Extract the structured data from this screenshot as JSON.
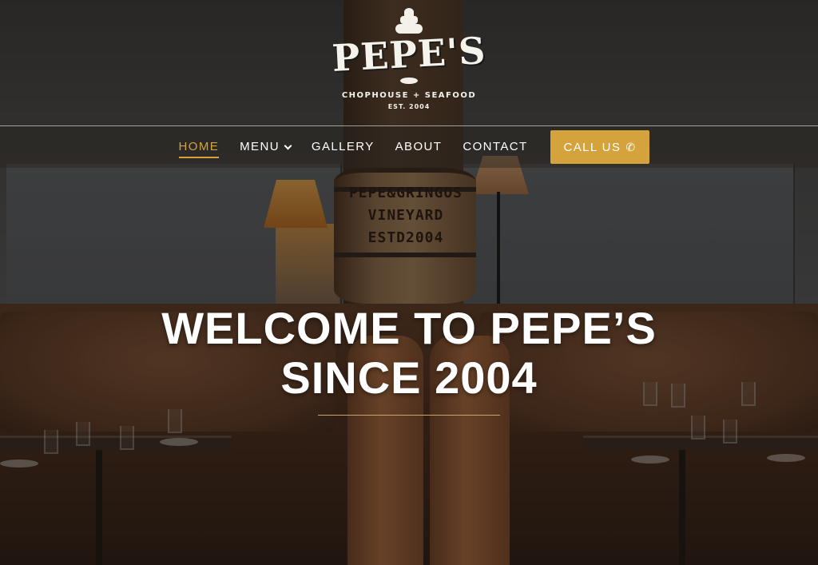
{
  "logo": {
    "title": "PEPE'S",
    "subtitle": "CHOPHOUSE + SEAFOOD",
    "established": "EST. 2004"
  },
  "nav": {
    "items": [
      {
        "label": "HOME",
        "active": true
      },
      {
        "label": "MENU",
        "has_dropdown": true
      },
      {
        "label": "GALLERY"
      },
      {
        "label": "ABOUT"
      },
      {
        "label": "CONTACT"
      }
    ],
    "call_button": {
      "label": "CALL US",
      "icon": "phone-icon"
    }
  },
  "background_sign": {
    "lines": [
      "PEPE&GRINGOS",
      "VINEYARD",
      "ESTD2004"
    ]
  },
  "hero": {
    "line1": "WELCOME TO PEPE’S",
    "line2": "SINCE 2004"
  },
  "colors": {
    "accent": "#d4a33c",
    "text": "#ffffff",
    "divider": "#c9a46a"
  }
}
